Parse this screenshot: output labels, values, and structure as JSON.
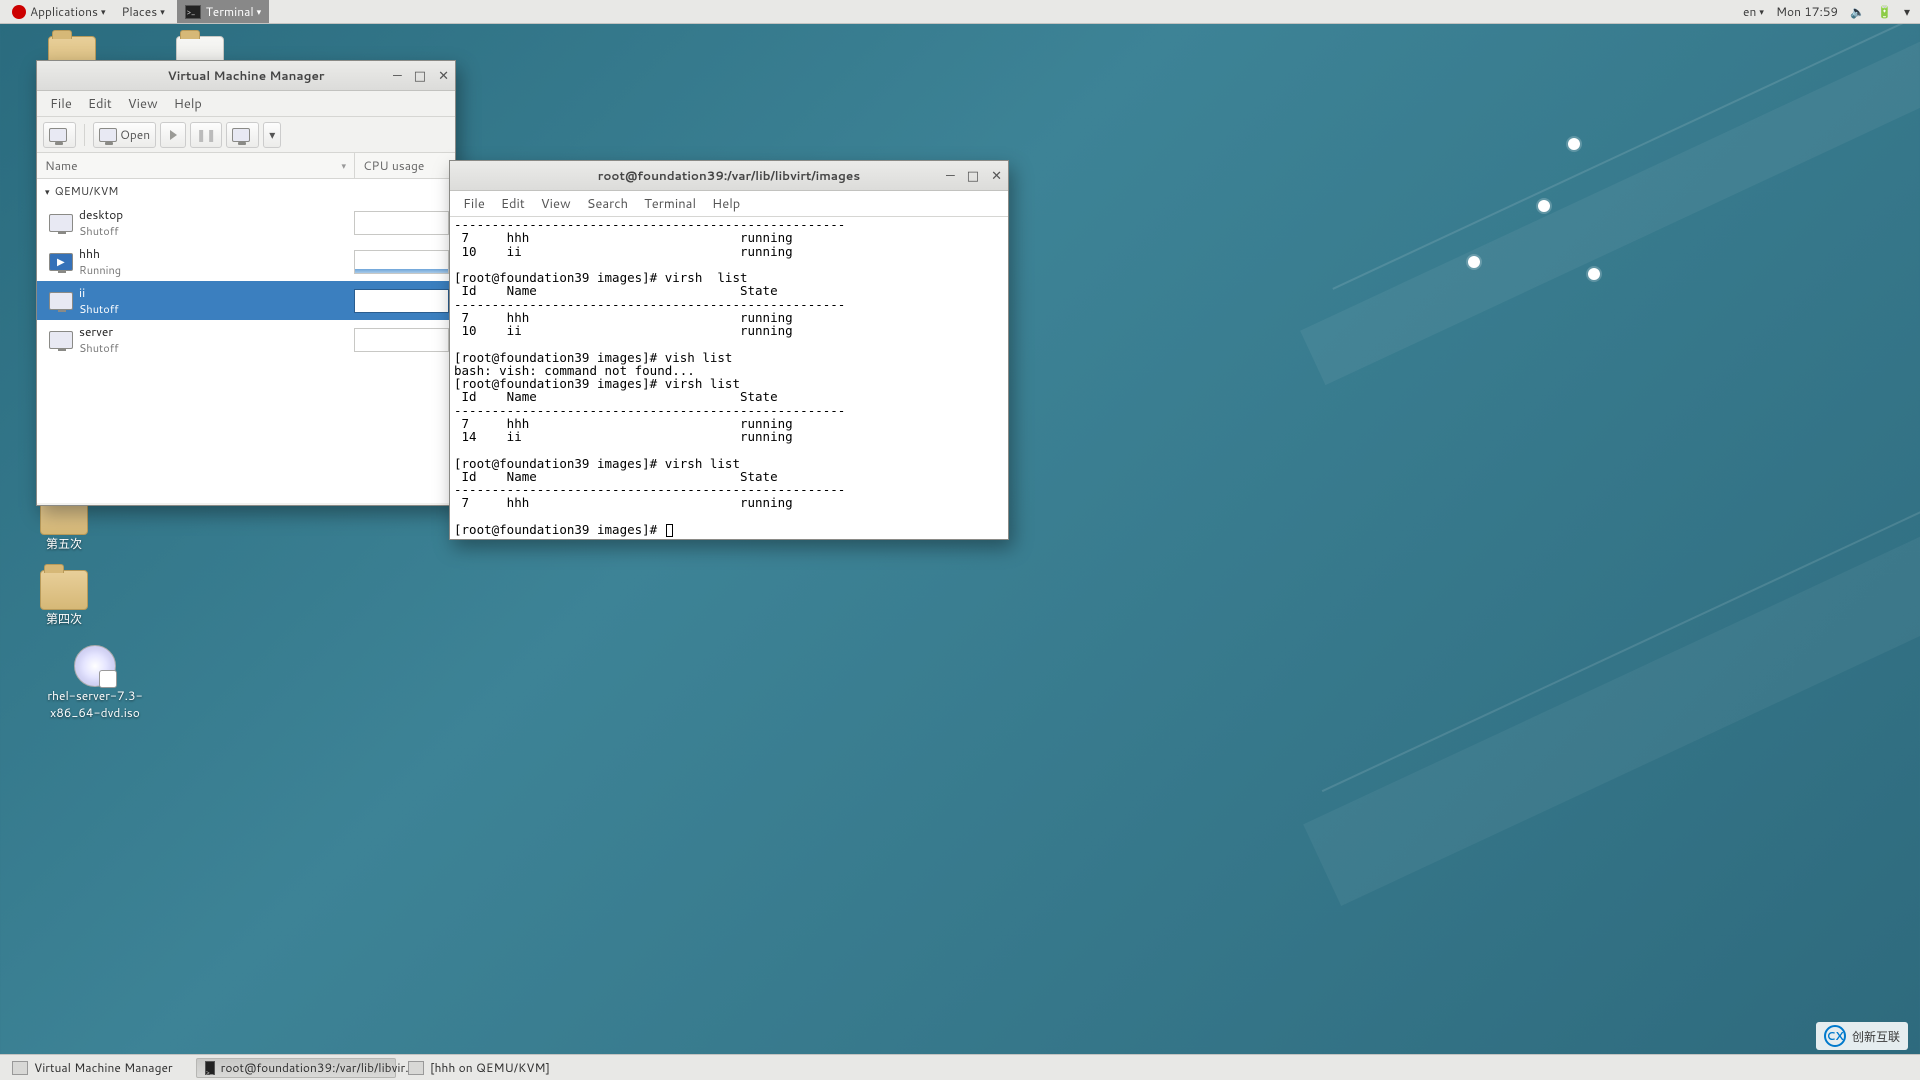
{
  "top_panel": {
    "applications": "Applications",
    "places": "Places",
    "active_app": "Terminal",
    "lang": "en",
    "clock": "Mon 17:59"
  },
  "desktop": {
    "icon_home": "",
    "icon_5": "第五次",
    "icon_4": "第四次",
    "icon_iso": "rhel-server-7.3-x86_64-dvd.iso"
  },
  "vmm": {
    "title": "Virtual Machine Manager",
    "menu": {
      "file": "File",
      "edit": "Edit",
      "view": "View",
      "help": "Help"
    },
    "toolbar": {
      "open": "Open"
    },
    "columns": {
      "name": "Name",
      "cpu": "CPU usage"
    },
    "group": "QEMU/KVM",
    "vms": [
      {
        "name": "desktop",
        "state": "Shutoff",
        "running": false,
        "selected": false
      },
      {
        "name": "hhh",
        "state": "Running",
        "running": true,
        "selected": false
      },
      {
        "name": "ii",
        "state": "Shutoff",
        "running": false,
        "selected": true
      },
      {
        "name": "server",
        "state": "Shutoff",
        "running": false,
        "selected": false
      }
    ]
  },
  "terminal": {
    "title": "root@foundation39:/var/lib/libvirt/images",
    "menu": {
      "file": "File",
      "edit": "Edit",
      "view": "View",
      "search": "Search",
      "terminal": "Terminal",
      "help": "Help"
    },
    "lines": [
      "----------------------------------------------------",
      " 7     hhh                            running",
      " 10    ii                             running",
      "",
      "[root@foundation39 images]# virsh  list",
      " Id    Name                           State",
      "----------------------------------------------------",
      " 7     hhh                            running",
      " 10    ii                             running",
      "",
      "[root@foundation39 images]# vish list",
      "bash: vish: command not found...",
      "[root@foundation39 images]# virsh list",
      " Id    Name                           State",
      "----------------------------------------------------",
      " 7     hhh                            running",
      " 14    ii                             running",
      "",
      "[root@foundation39 images]# virsh list",
      " Id    Name                           State",
      "----------------------------------------------------",
      " 7     hhh                            running",
      "",
      "[root@foundation39 images]# "
    ]
  },
  "taskbar": {
    "items": [
      {
        "label": "Virtual Machine Manager",
        "active": false,
        "kind": "vmm"
      },
      {
        "label": "root@foundation39:/var/lib/libvir...",
        "active": true,
        "kind": "term"
      },
      {
        "label": "[hhh on QEMU/KVM]",
        "active": false,
        "kind": "vmm"
      }
    ]
  },
  "watermark": "创新互联"
}
